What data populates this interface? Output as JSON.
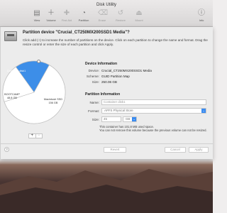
{
  "window": {
    "title": "Disk Utility"
  },
  "toolbar": {
    "items": [
      {
        "label": "View",
        "icon": "view-icon",
        "dim": false
      },
      {
        "label": "Volume",
        "icon": "volume-icon",
        "dim": false
      },
      {
        "label": "First Aid",
        "icon": "first-aid-icon",
        "dim": true
      },
      {
        "label": "Partition",
        "icon": "partition-icon",
        "dim": false
      },
      {
        "label": "Erase",
        "icon": "erase-icon",
        "dim": true
      },
      {
        "label": "Restore",
        "icon": "restore-icon",
        "dim": true
      },
      {
        "label": "Mount",
        "icon": "mount-icon",
        "dim": true
      },
      {
        "label": "Info",
        "icon": "info-icon",
        "dim": false
      }
    ]
  },
  "sheet": {
    "title": "Partition device \"Crucial_CT250MX200SSD1 Media\"?",
    "subtitle": "Click add (+) to increase the number of partitions on the device. Click on each partition to change the name and format. Drag the resize control or enter the size of each partition and click Apply."
  },
  "pie": {
    "slices": [
      {
        "name": "Container disk1",
        "size": "45 GB",
        "fraction": 0.18,
        "color": "#3d8ee8"
      },
      {
        "name": "Macintosh SSD",
        "size": "156 GB",
        "fraction": 0.62,
        "color": "#ffffff"
      },
      {
        "name": "BOOTCAMP",
        "size": "48.8 GB",
        "fraction": 0.2,
        "color": "#ffffff"
      }
    ],
    "add_label": "+",
    "remove_label": "−"
  },
  "device_info": {
    "heading": "Device Information",
    "device_label": "Device:",
    "device_value": "Crucial_CT250MX200SSD1 Media",
    "scheme_label": "Scheme:",
    "scheme_value": "GUID Partition Map",
    "size_label": "Size:",
    "size_value": "250.06 GB"
  },
  "partition_info": {
    "heading": "Partition Information",
    "name_label": "Name:",
    "name_placeholder": "Container disk1",
    "format_label": "Format:",
    "format_value": "APFS Physical Store",
    "size_label": "Size:",
    "size_value": "45",
    "size_unit": "GB",
    "note_line1": "This container has 101.8 MB used space.",
    "note_line2": "You can not remove this volume because the previous volume can not be resized."
  },
  "buttons": {
    "help": "?",
    "revert": "Revert",
    "cancel": "Cancel",
    "apply": "Apply"
  },
  "colors": {
    "accent": "#3d8ee8"
  }
}
